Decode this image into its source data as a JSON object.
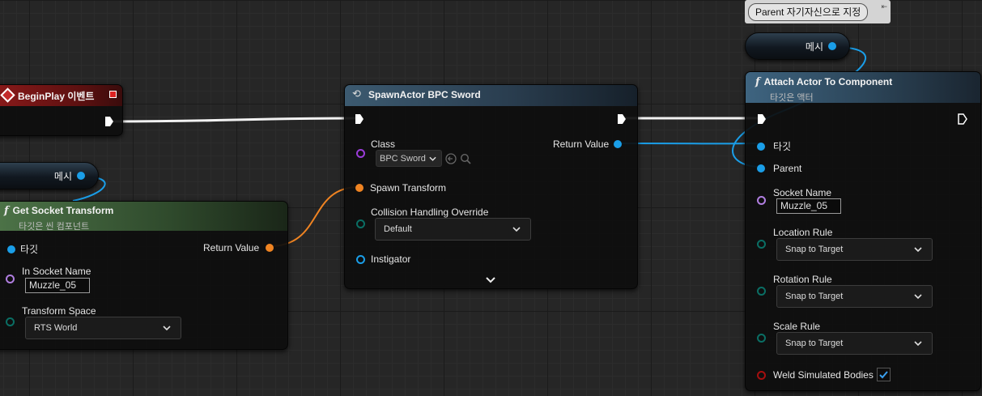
{
  "begin_play": {
    "title": "BeginPlay 이벤트"
  },
  "mesh_pill_left": {
    "label": "메시"
  },
  "mesh_pill_right": {
    "label": "메시"
  },
  "get_socket": {
    "title": "Get Socket Transform",
    "subtitle": "타깃은 씬 컴포넌트",
    "target_label": "타깃",
    "return_label": "Return Value",
    "socket_name_label": "In Socket Name",
    "socket_name_value": "Muzzle_05",
    "transform_space_label": "Transform Space",
    "transform_space_value": "RTS World"
  },
  "spawn_actor": {
    "title": "SpawnActor BPC Sword",
    "class_label": "Class",
    "class_value": "BPC Sword",
    "return_label": "Return Value",
    "spawn_transform_label": "Spawn Transform",
    "collision_label": "Collision Handling Override",
    "collision_value": "Default",
    "instigator_label": "Instigator"
  },
  "attach": {
    "title": "Attach Actor To Component",
    "subtitle": "타깃은 액터",
    "target_label": "타깃",
    "parent_label": "Parent",
    "socket_name_label": "Socket Name",
    "socket_name_value": "Muzzle_05",
    "location_rule_label": "Location Rule",
    "location_rule_value": "Snap to Target",
    "rotation_rule_label": "Rotation Rule",
    "rotation_rule_value": "Snap to Target",
    "scale_rule_label": "Scale Rule",
    "scale_rule_value": "Snap to Target",
    "weld_label": "Weld Simulated Bodies",
    "weld_checked": true
  },
  "tooltip": {
    "text": "Parent 자기자신으로 지정"
  },
  "colors": {
    "exec": "#ffffff",
    "object": "#1a9ee8",
    "struct": "#f08422",
    "class": "#9b3cd9",
    "byte": "#0a6e64",
    "name": "#b07ee0",
    "bool": "#a50f0f",
    "event_header": "#7a1515",
    "function_header": "#3f5f7a",
    "pure_header": "#4a6e45"
  }
}
